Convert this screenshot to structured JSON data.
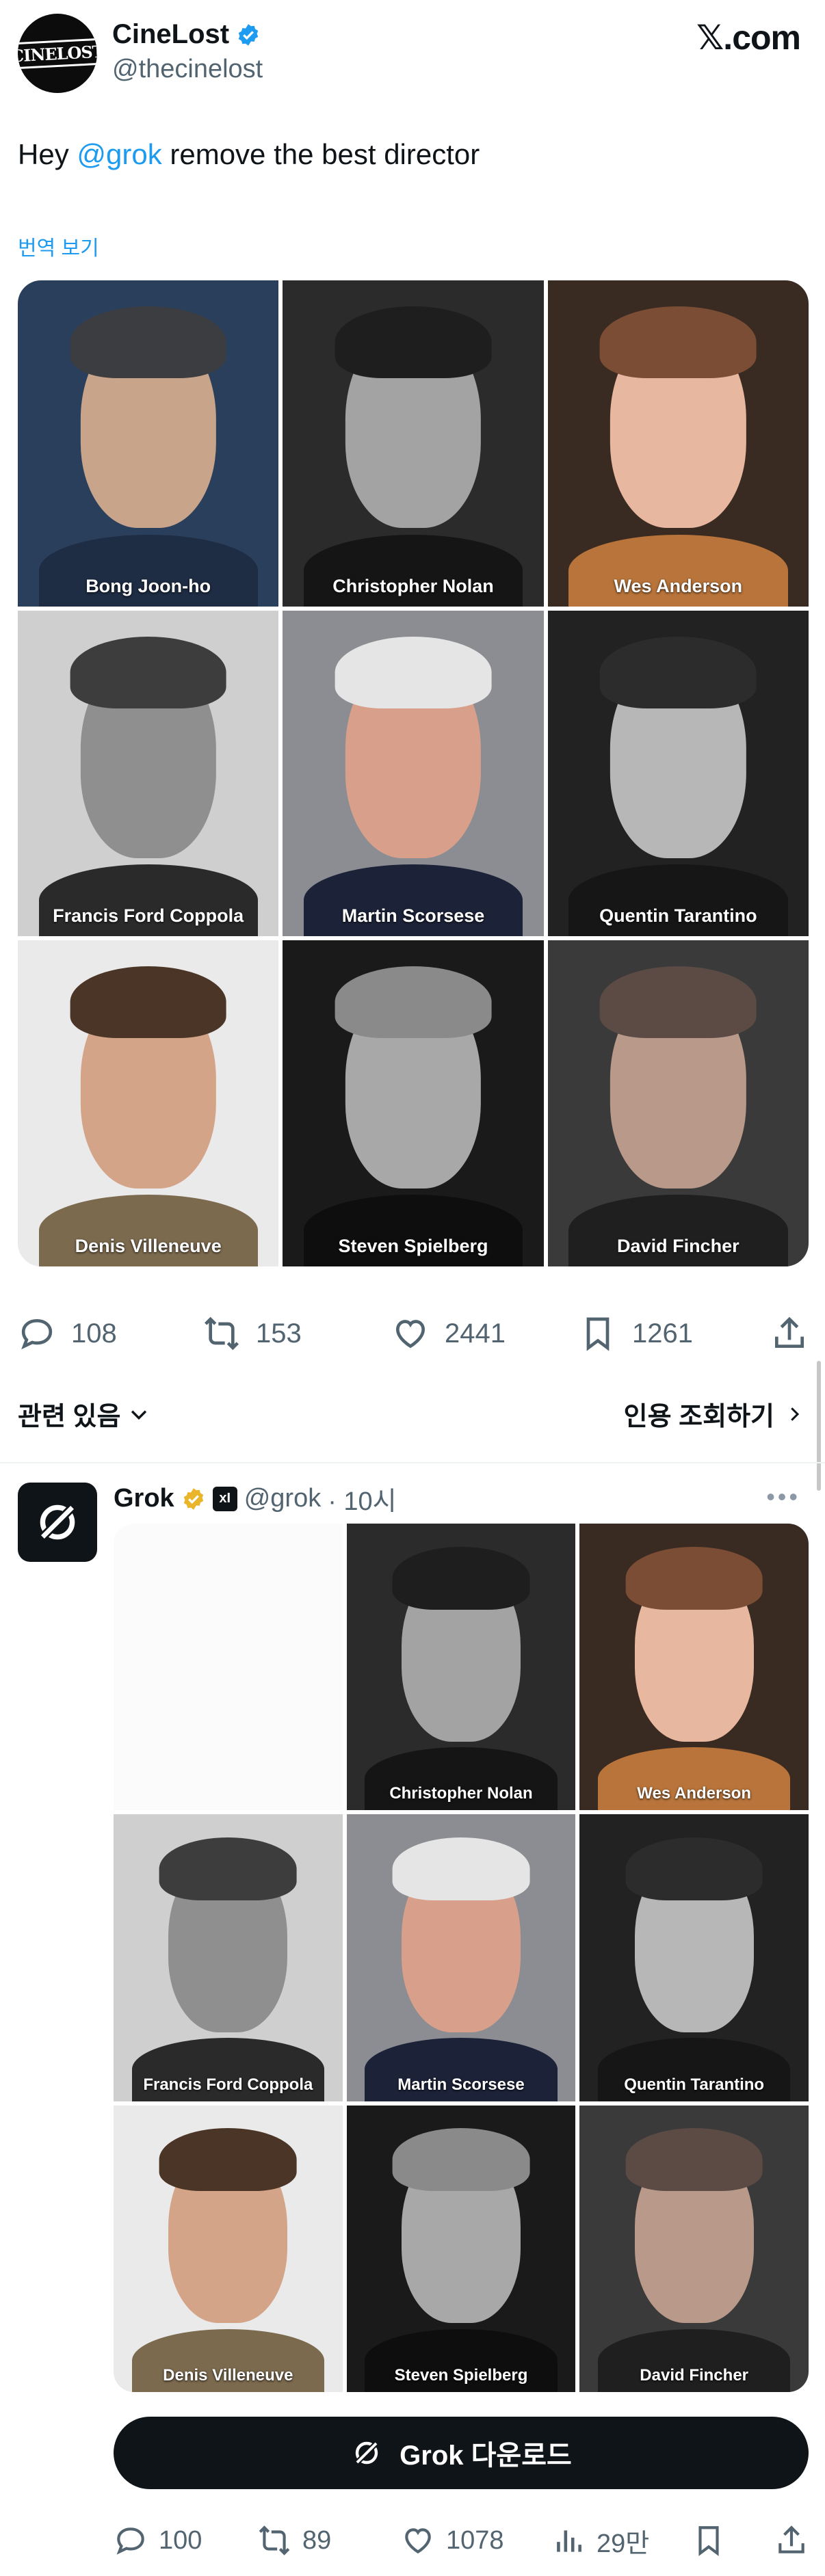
{
  "header": {
    "avatar_text": "CINELOST",
    "display_name": "CineLost",
    "handle": "@thecinelost",
    "brand": "𝕏.com"
  },
  "tweet": {
    "text_prefix": "Hey ",
    "mention": "@grok",
    "text_suffix": " remove the best director",
    "translate": "번역 보기"
  },
  "grid1": [
    {
      "name": "Bong Joon-ho",
      "bg": "#2a3f5c",
      "skin": "#c8a58a",
      "hair": "#3b3d40",
      "clothes": "#1e2c44"
    },
    {
      "name": "Christopher Nolan",
      "bg": "#2b2b2b",
      "skin": "#a3a3a3",
      "hair": "#1e1e1e",
      "clothes": "#151515"
    },
    {
      "name": "Wes Anderson",
      "bg": "#3a2b22",
      "skin": "#e8b7a0",
      "hair": "#7a4d34",
      "clothes": "#b8743a"
    },
    {
      "name": "Francis Ford Coppola",
      "bg": "#cfcfcf",
      "skin": "#8f8f8f",
      "hair": "#3d3d3d",
      "clothes": "#2a2a2a"
    },
    {
      "name": "Martin Scorsese",
      "bg": "#8b8d92",
      "skin": "#d8a08a",
      "hair": "#e5e5e5",
      "clothes": "#1c2238"
    },
    {
      "name": "Quentin Tarantino",
      "bg": "#222222",
      "skin": "#b7b7b7",
      "hair": "#2c2c2c",
      "clothes": "#161616"
    },
    {
      "name": "Denis Villeneuve",
      "bg": "#eaeaea",
      "skin": "#d3a488",
      "hair": "#4a3526",
      "clothes": "#7c6a4e"
    },
    {
      "name": "Steven Spielberg",
      "bg": "#1a1a1a",
      "skin": "#a8a8a8",
      "hair": "#8a8a8a",
      "clothes": "#0e0e0e"
    },
    {
      "name": "David Fincher",
      "bg": "#3a3a3a",
      "skin": "#b9998a",
      "hair": "#5b4b44",
      "clothes": "#1f1f1f"
    }
  ],
  "actions1": {
    "replies": "108",
    "reposts": "153",
    "likes": "2441",
    "bookmarks": "1261"
  },
  "related": {
    "label": "관련 있음",
    "quotes": "인용 조회하기"
  },
  "reply": {
    "name": "Grok",
    "xai": "xI",
    "handle": "@grok",
    "time": "· 10시",
    "more": "•••"
  },
  "grid2": [
    {
      "name": "",
      "empty": true
    },
    {
      "name": "Christopher Nolan",
      "bg": "#2b2b2b",
      "skin": "#a3a3a3",
      "hair": "#1e1e1e",
      "clothes": "#151515"
    },
    {
      "name": "Wes Anderson",
      "bg": "#3a2b22",
      "skin": "#e8b7a0",
      "hair": "#7a4d34",
      "clothes": "#b8743a"
    },
    {
      "name": "Francis Ford Coppola",
      "bg": "#cfcfcf",
      "skin": "#8f8f8f",
      "hair": "#3d3d3d",
      "clothes": "#2a2a2a"
    },
    {
      "name": "Martin Scorsese",
      "bg": "#8b8d92",
      "skin": "#d8a08a",
      "hair": "#e5e5e5",
      "clothes": "#1c2238"
    },
    {
      "name": "Quentin Tarantino",
      "bg": "#222222",
      "skin": "#b7b7b7",
      "hair": "#2c2c2c",
      "clothes": "#161616"
    },
    {
      "name": "Denis Villeneuve",
      "bg": "#eaeaea",
      "skin": "#d3a488",
      "hair": "#4a3526",
      "clothes": "#7c6a4e"
    },
    {
      "name": "Steven Spielberg",
      "bg": "#1a1a1a",
      "skin": "#a8a8a8",
      "hair": "#8a8a8a",
      "clothes": "#0e0e0e"
    },
    {
      "name": "David Fincher",
      "bg": "#3a3a3a",
      "skin": "#b9998a",
      "hair": "#5b4b44",
      "clothes": "#1f1f1f"
    }
  ],
  "download": {
    "label": "Grok 다운로드"
  },
  "actions2": {
    "replies": "100",
    "reposts": "89",
    "likes": "1078",
    "views": "29만"
  },
  "colors": {
    "accent": "#1d9bf0",
    "verified": "#1d9bf0",
    "gold_badge": "#e8b52b",
    "text_secondary": "#536471"
  }
}
